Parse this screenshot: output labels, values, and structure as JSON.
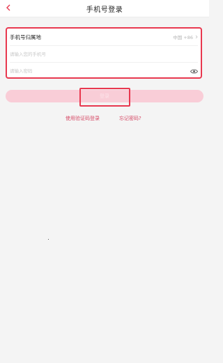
{
  "header": {
    "title": "手机号登录",
    "back_icon": "chevron-left-icon",
    "accent": "#e8384f"
  },
  "form": {
    "region_label": "手机号归属地",
    "region_value": "中国 +86",
    "phone_placeholder": "请输入您的手机号",
    "password_placeholder": "请输入密码",
    "eye_icon": "eye-icon"
  },
  "login_button": {
    "label": "登录",
    "color": "#f9cdd7"
  },
  "links": {
    "code_login": "使用验证码登录",
    "forgot_password": "忘记密码?",
    "color": "#d64a66"
  }
}
